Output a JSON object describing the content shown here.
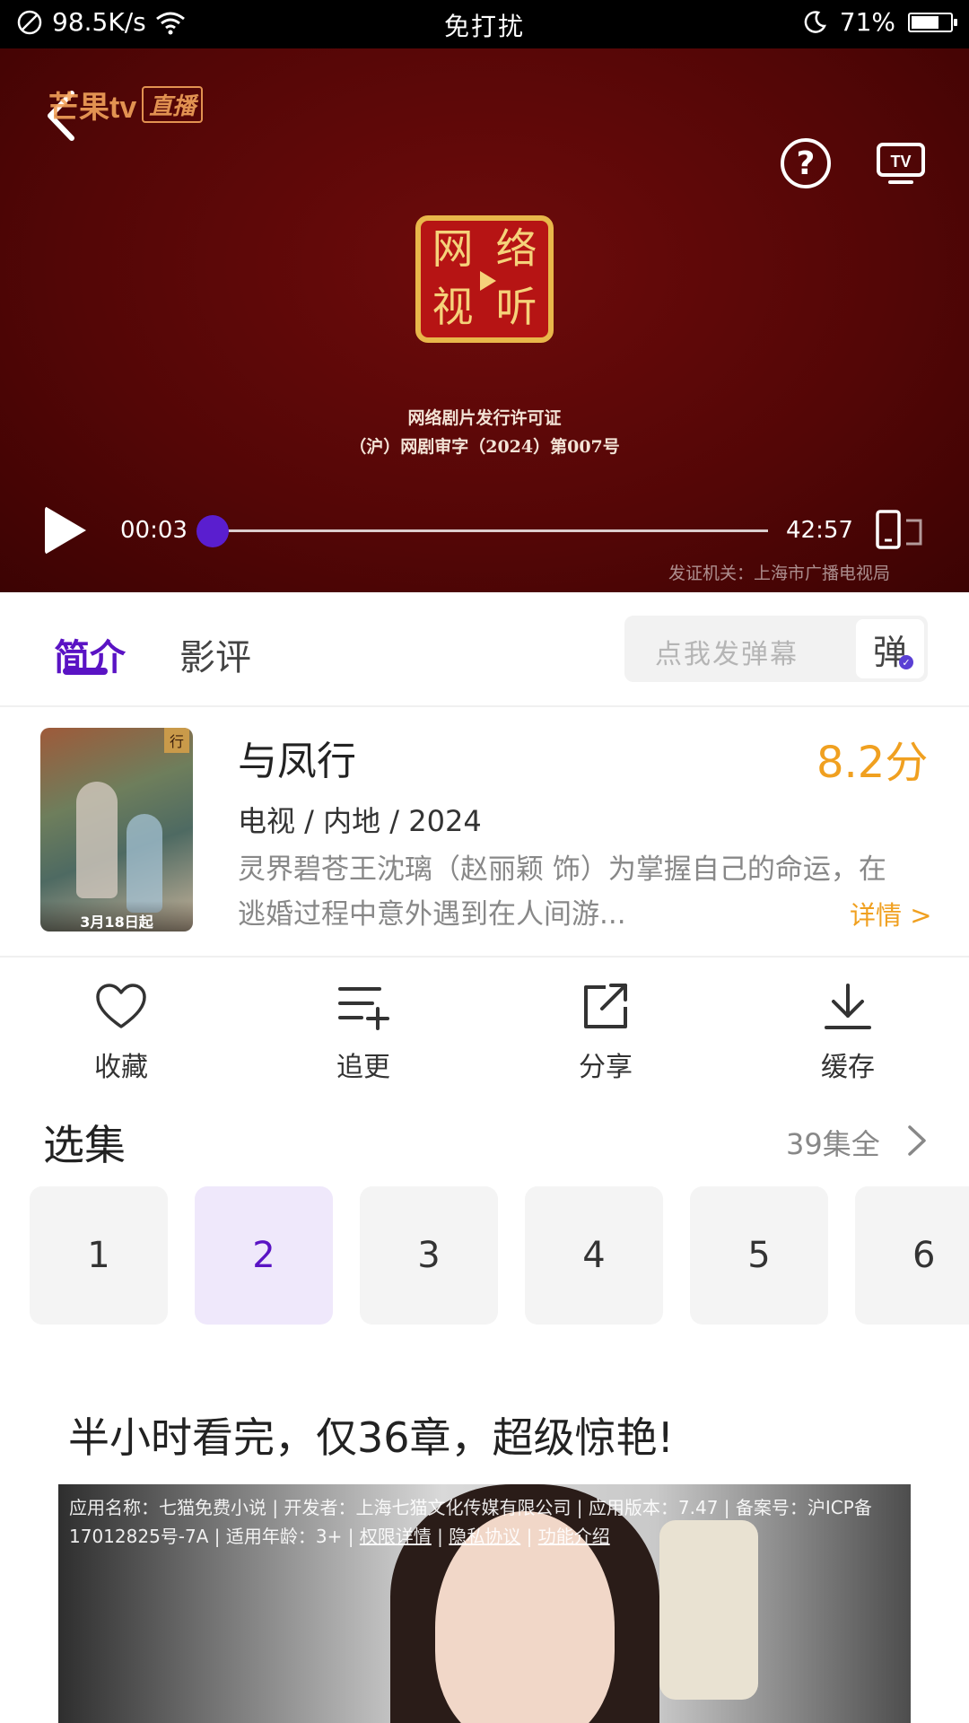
{
  "status_bar": {
    "net_speed": "98.5K/s",
    "center": "免打扰",
    "battery": "71%",
    "battery_level": 0.71
  },
  "player": {
    "brand": "芒果tv",
    "brand_live": "直播",
    "help": "?",
    "seal_chars": [
      "网",
      "络",
      "视",
      "听"
    ],
    "license_line1": "网络剧片发行许可证",
    "license_line2": "（沪）网剧审字（2024）第007号",
    "issuer": "发证机关：上海市广播电视局",
    "time_current": "00:03",
    "time_total": "42:57",
    "progress": 0.0012
  },
  "tabs": [
    {
      "label": "简介",
      "active": true
    },
    {
      "label": "影评",
      "active": false
    }
  ],
  "danmaku": {
    "placeholder": "点我发弹幕",
    "button": "弹"
  },
  "show": {
    "poster_tag": "行",
    "poster_date": "3月18日起",
    "title": "与凤行",
    "score": "8.2分",
    "meta": "电视 / 内地 / 2024",
    "description": "灵界碧苍王沈璃（赵丽颖 饰）为掌握自己的命运，在逃婚过程中意外遇到在人间游...",
    "detail_link": "详情 >"
  },
  "actions": [
    {
      "label": "收藏",
      "icon": "heart-icon"
    },
    {
      "label": "追更",
      "icon": "playlist-add-icon"
    },
    {
      "label": "分享",
      "icon": "share-icon"
    },
    {
      "label": "缓存",
      "icon": "download-icon"
    }
  ],
  "episodes": {
    "title": "选集",
    "count": "39集全",
    "items": [
      "1",
      "2",
      "3",
      "4",
      "5",
      "6"
    ],
    "selected": "2"
  },
  "ad": {
    "headline": "半小时看完，仅36章，超级惊艳!",
    "info_prefix": "应用名称：七猫免费小说 | 开发者：上海七猫文化传媒有限公司 | 应用版本：7.47 | 备案号：沪ICP备17012825号-7A | 适用年龄：3+ | ",
    "link_permissions": "权限详情",
    "link_privacy": "隐私协议",
    "link_features": "功能介绍",
    "sep": " | "
  }
}
